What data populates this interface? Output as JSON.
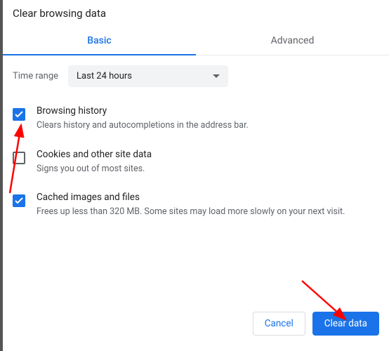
{
  "title": "Clear browsing data",
  "tabs": {
    "basic": "Basic",
    "advanced": "Advanced"
  },
  "time": {
    "label": "Time range",
    "value": "Last 24 hours"
  },
  "options": [
    {
      "title": "Browsing history",
      "desc": "Clears history and autocompletions in the address bar.",
      "checked": true
    },
    {
      "title": "Cookies and other site data",
      "desc": "Signs you out of most sites.",
      "checked": false
    },
    {
      "title": "Cached images and files",
      "desc": "Frees up less than 320 MB. Some sites may load more slowly on your next visit.",
      "checked": true
    }
  ],
  "buttons": {
    "cancel": "Cancel",
    "clear": "Clear data"
  }
}
